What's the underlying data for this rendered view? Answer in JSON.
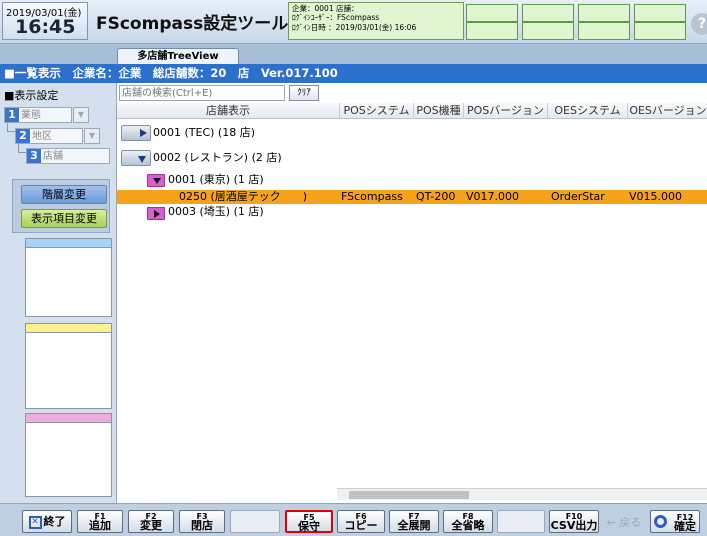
{
  "header": {
    "date": "2019/03/01(金)",
    "time": "16:45",
    "title": "FScompass設定ツール",
    "info_line1": "企業：0001 店舗：",
    "info_line2": "ﾛｸﾞｲﾝﾕｰｻﾞｰ：FScompass",
    "info_line3": "ﾛｸﾞｲﾝ日時 ：2019/03/01(金) 16:06",
    "help_icon": "?"
  },
  "tab": {
    "label": "多店舗TreeView"
  },
  "infobar": {
    "text": "■一覧表示　企業名：企業　総店舗数：20　店　Ver.017.100"
  },
  "left": {
    "disp_setting": "■表示設定",
    "levels": [
      {
        "num": "1",
        "label": "業態"
      },
      {
        "num": "2",
        "label": "地区"
      },
      {
        "num": "3",
        "label": "店舗"
      }
    ],
    "btn_hierarchy": "階層変更",
    "btn_columns": "表示項目変更",
    "memo_colors": [
      "#a9d3f5",
      "#fff28a",
      "#f4a9df"
    ]
  },
  "search": {
    "placeholder": "店舗の検索(Ctrl+E)",
    "clear_label": "ｸﾘｱ"
  },
  "columns": [
    "店舗表示",
    "POSシステム",
    "POS機種",
    "POSバージョン",
    "OESシステム",
    "OESバージョン"
  ],
  "tree": {
    "node1": "0001 (TEC) (18 店)",
    "node2": "0002 (レストラン) (2 店)",
    "node2a": "0001 (東京) (1 店)",
    "selected": {
      "name": "0250 (居酒屋テック　　)",
      "pos_system": "FScompass",
      "pos_model": "QT-200",
      "pos_version": "V017.000",
      "oes_system": "OrderStar",
      "oes_version": "V015.000"
    },
    "node2b": "0003 (埼玉) (1 店)"
  },
  "fkeys": {
    "f_end_label": "終了",
    "f1": {
      "fn": "F1",
      "label": "追加"
    },
    "f2": {
      "fn": "F2",
      "label": "変更"
    },
    "f3": {
      "fn": "F3",
      "label": "閉店"
    },
    "f5": {
      "fn": "F5",
      "label": "保守"
    },
    "f6": {
      "fn": "F6",
      "label": "コピー"
    },
    "f7": {
      "fn": "F7",
      "label": "全展開"
    },
    "f8": {
      "fn": "F8",
      "label": "全省略"
    },
    "f10": {
      "fn": "F10",
      "label": "CSV出力"
    },
    "back": "← 戻る",
    "f12": {
      "fn": "F12",
      "label": "確定"
    }
  }
}
